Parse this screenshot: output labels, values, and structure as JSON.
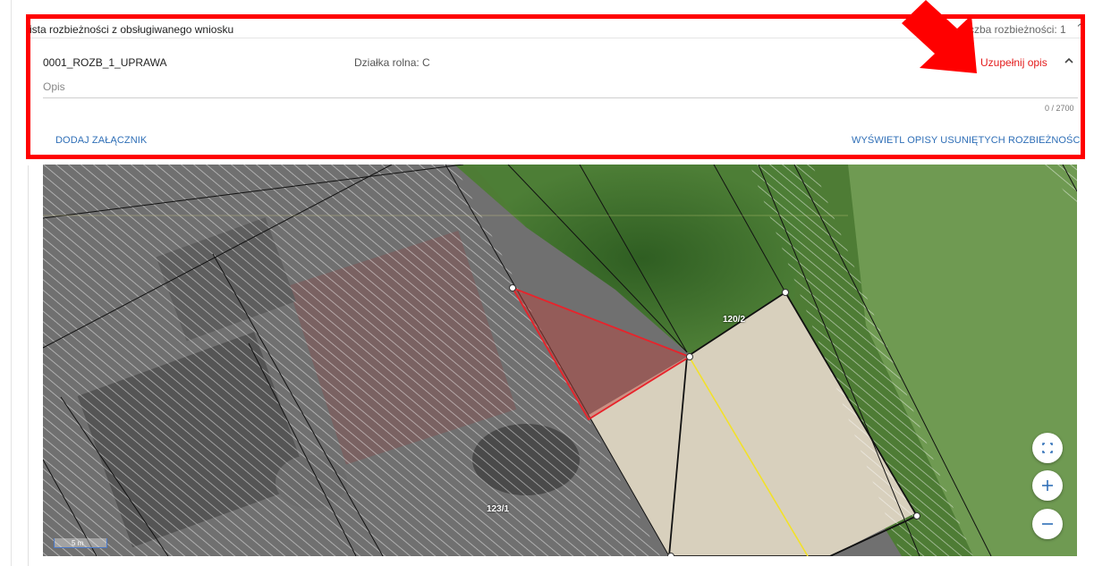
{
  "list_panel": {
    "title": "ista rozbieżności z obsługiwanego wniosku",
    "count_text": "czba rozbieżności: 1"
  },
  "discrepancy": {
    "id": "0001_ROZB_1_UPRAWA",
    "parcel": "Działka rolna: C",
    "action_label": "Uzupełnij opis",
    "description_label": "Opis",
    "char_counter": "0 / 2700"
  },
  "buttons": {
    "add_attachment": "DODAJ ZAŁĄCZNIK",
    "show_removed": "WYŚWIETL OPISY USUNIĘTYCH ROZBIEŻNOŚCI"
  },
  "map": {
    "parcel_labels": [
      "120/2",
      "123/1"
    ],
    "scale_label": "5 m",
    "controls": [
      "fullscreen-icon",
      "plus-icon",
      "minus-icon"
    ]
  },
  "colors": {
    "highlight": "#ff0000",
    "action": "#e31b1b",
    "button_text": "#2f6fb7",
    "parcel_outline": "#e8232b",
    "boundary_yellow": "#f2e12a"
  }
}
